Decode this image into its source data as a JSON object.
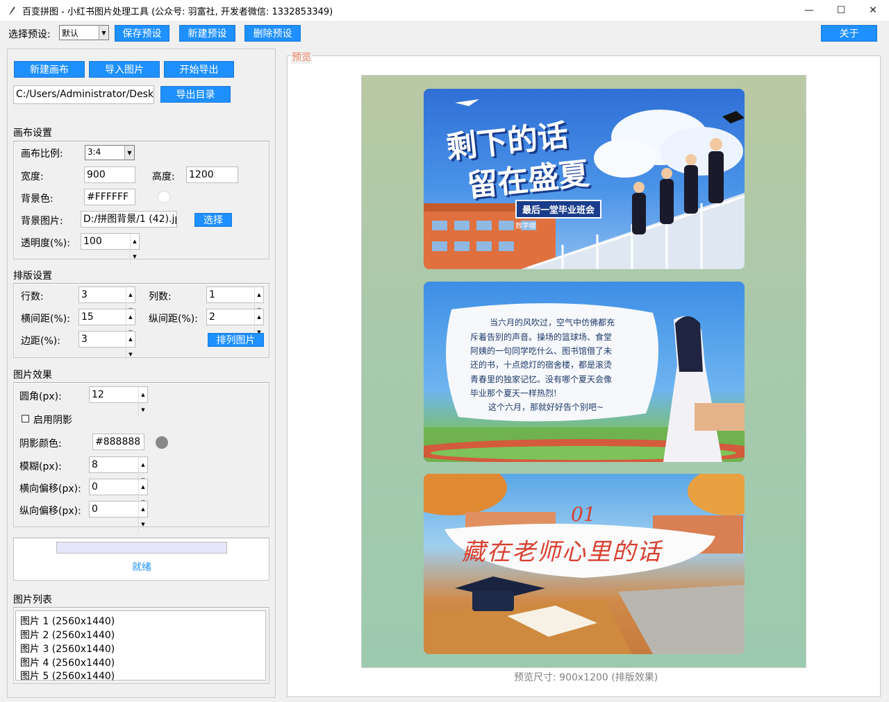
{
  "window": {
    "title": "百变拼图 - 小红书图片处理工具 (公众号: 羽富社, 开发者微信: 1332853349)",
    "min": "—",
    "max": "☐",
    "close": "✕"
  },
  "toolbar": {
    "preset_label": "选择预设:",
    "preset_value": "默认",
    "save_preset": "保存预设",
    "new_preset": "新建预设",
    "delete_preset": "删除预设",
    "about": "关于"
  },
  "actions": {
    "new_canvas": "新建画布",
    "import_images": "导入图片",
    "start_export": "开始导出",
    "export_path": "C:/Users/Administrator/Deskt",
    "export_dir": "导出目录"
  },
  "canvas_settings": {
    "title": "画布设置",
    "ratio_label": "画布比例:",
    "ratio_value": "3:4",
    "width_label": "宽度:",
    "width_value": "900",
    "height_label": "高度:",
    "height_value": "1200",
    "bg_color_label": "背景色:",
    "bg_color_value": "#FFFFFF",
    "bg_image_label": "背景图片:",
    "bg_image_value": "D:/拼图背景/1 (42).jp",
    "choose": "选择",
    "opacity_label": "透明度(%):",
    "opacity_value": "100"
  },
  "layout_settings": {
    "title": "排版设置",
    "rows_label": "行数:",
    "rows_value": "3",
    "cols_label": "列数:",
    "cols_value": "1",
    "hgap_label": "横间距(%):",
    "hgap_value": "15",
    "vgap_label": "纵间距(%):",
    "vgap_value": "2",
    "margin_label": "边距(%):",
    "margin_value": "3",
    "arrange": "排列图片"
  },
  "image_effects": {
    "title": "图片效果",
    "radius_label": "圆角(px):",
    "radius_value": "12",
    "shadow_label": "启用阴影",
    "shadow_color_label": "阴影颜色:",
    "shadow_color_value": "#888888",
    "blur_label": "模糊(px):",
    "blur_value": "8",
    "hoffset_label": "横向偏移(px):",
    "hoffset_value": "0",
    "voffset_label": "纵向偏移(px):",
    "voffset_value": "0"
  },
  "progress": {
    "status": "就绪",
    "value": 0
  },
  "image_list": {
    "title": "图片列表",
    "items": [
      "图片 1 (2560x1440)",
      "图片 2 (2560x1440)",
      "图片 3 (2560x1440)",
      "图片 4 (2560x1440)",
      "图片 5 (2560x1440)"
    ]
  },
  "preview": {
    "legend": "预览",
    "size_text": "预览尺寸: 900x1200 (排版效果)",
    "card1": {
      "line1": "剩下的话",
      "line2": "留在盛夏",
      "subtitle": "最后一堂毕业班会",
      "sign": "数学楼"
    },
    "card2": {
      "p1": "当六月的风吹过，空气中仿佛都充",
      "p2": "斥着告别的声音。操场的篮球场、食堂",
      "p3": "阿姨的一句同学吃什么、图书馆借了未",
      "p4": "还的书，十点熄灯的宿舍楼，都是滚烫",
      "p5": "青春里的独家记忆。没有哪个夏天会像",
      "p6": "毕业那个夏天一样热烈!",
      "p7": "这个六月，那就好好告个别吧~"
    },
    "card3": {
      "num": "01",
      "title": "藏在老师心里的话"
    }
  },
  "colors": {
    "accent": "#1e90ff",
    "legend": "#f08060",
    "shadow_swatch": "#888888"
  }
}
